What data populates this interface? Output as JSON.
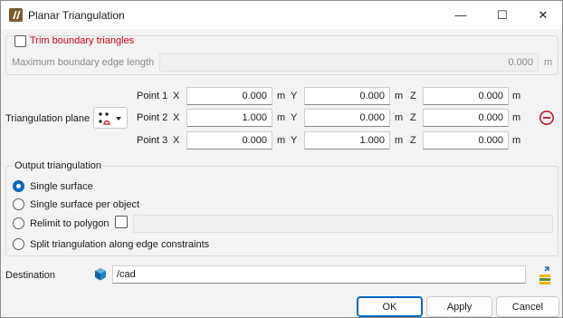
{
  "window": {
    "title": "Planar Triangulation",
    "minimize": "—",
    "maximize": "☐",
    "close": "✕"
  },
  "trim": {
    "label": "Trim boundary triangles",
    "checked": false
  },
  "max_edge": {
    "label": "Maximum boundary edge length",
    "value": "0.000",
    "unit": "m"
  },
  "plane": {
    "label": "Triangulation plane",
    "points": [
      {
        "label": "Point 1",
        "x": "0.000",
        "y": "0.000",
        "z": "0.000"
      },
      {
        "label": "Point 2",
        "x": "1.000",
        "y": "0.000",
        "z": "0.000"
      },
      {
        "label": "Point 3",
        "x": "0.000",
        "y": "1.000",
        "z": "0.000"
      }
    ],
    "axis_x": "X",
    "axis_y": "Y",
    "axis_z": "Z",
    "unit": "m"
  },
  "output": {
    "title": "Output triangulation",
    "options": [
      {
        "label": "Single surface",
        "selected": true
      },
      {
        "label": "Single surface per object",
        "selected": false
      },
      {
        "label": "Relimit to polygon",
        "selected": false
      },
      {
        "label": "Split triangulation along edge constraints",
        "selected": false
      }
    ]
  },
  "destination": {
    "label": "Destination",
    "value": "/cad"
  },
  "buttons": {
    "ok": "OK",
    "apply": "Apply",
    "cancel": "Cancel"
  },
  "colors": {
    "accent": "#0067c0",
    "warning_red": "#d0021b",
    "remove_icon": "#c8102e"
  }
}
